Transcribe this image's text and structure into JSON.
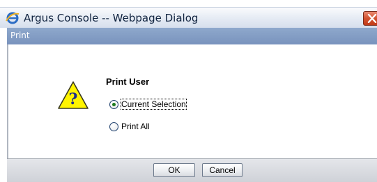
{
  "window": {
    "title": "Argus Console -- Webpage Dialog",
    "browser_icon": "ie-icon",
    "close_icon": "close-icon"
  },
  "dialog": {
    "header_label": "Print",
    "icon": "warning-question-icon",
    "group_title": "Print User",
    "options": [
      {
        "label": "Current Selection",
        "selected": true,
        "focused": true
      },
      {
        "label": "Print All",
        "selected": false,
        "focused": false
      }
    ],
    "buttons": {
      "ok_label": "OK",
      "cancel_label": "Cancel"
    }
  },
  "colors": {
    "header_bar": "#7f99c4",
    "close_button": "#d2522f",
    "footer": "#d8dbe0",
    "warning_fill": "#fff400"
  }
}
